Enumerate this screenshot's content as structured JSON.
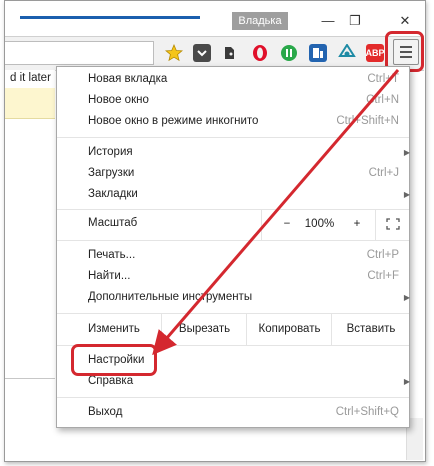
{
  "window": {
    "profile_name": "Владька",
    "minimize": "—",
    "restore": "❐",
    "close": "✕"
  },
  "toolbar": {
    "extensions": [
      {
        "name": "star-icon",
        "color": "#f2c211"
      },
      {
        "name": "pocket-icon",
        "color": "#4a4a4a"
      },
      {
        "name": "evernote-icon",
        "color": "#3c3c3c"
      },
      {
        "name": "opera-icon",
        "color": "#e0102a"
      },
      {
        "name": "ext-green-icon",
        "color": "#2aa84a"
      },
      {
        "name": "ext-blue-icon",
        "color": "#2364b0"
      },
      {
        "name": "ext-teal-icon",
        "color": "#1e8ba5"
      },
      {
        "name": "adblock-icon",
        "color": "#e32b2b",
        "text": "ABP"
      }
    ],
    "menu_icon": "hamburger-menu-icon"
  },
  "page": {
    "partial_text": "d it later"
  },
  "menu": {
    "group1": [
      {
        "label": "Новая вкладка",
        "shortcut": "Ctrl+T"
      },
      {
        "label": "Новое окно",
        "shortcut": "Ctrl+N"
      },
      {
        "label": "Новое окно в режиме инкогнито",
        "shortcut": "Ctrl+Shift+N"
      }
    ],
    "group2": [
      {
        "label": "История",
        "shortcut": ""
      },
      {
        "label": "Загрузки",
        "shortcut": "Ctrl+J"
      },
      {
        "label": "Закладки",
        "shortcut": ""
      }
    ],
    "zoom": {
      "label": "Масштаб",
      "minus": "−",
      "value": "100%",
      "plus": "+"
    },
    "group3": [
      {
        "label": "Печать...",
        "shortcut": "Ctrl+P"
      },
      {
        "label": "Найти...",
        "shortcut": "Ctrl+F"
      },
      {
        "label": "Дополнительные инструменты",
        "shortcut": ""
      }
    ],
    "edit": {
      "label": "Изменить",
      "cut": "Вырезать",
      "copy": "Копировать",
      "paste": "Вставить"
    },
    "group4": [
      {
        "label": "Настройки",
        "shortcut": ""
      },
      {
        "label": "Справка",
        "shortcut": ""
      }
    ],
    "exit": {
      "label": "Выход",
      "shortcut": "Ctrl+Shift+Q"
    },
    "submenu_arrow": "▶"
  },
  "colors": {
    "highlight": "#d4282f",
    "accent_tab": "#1b5fae"
  }
}
